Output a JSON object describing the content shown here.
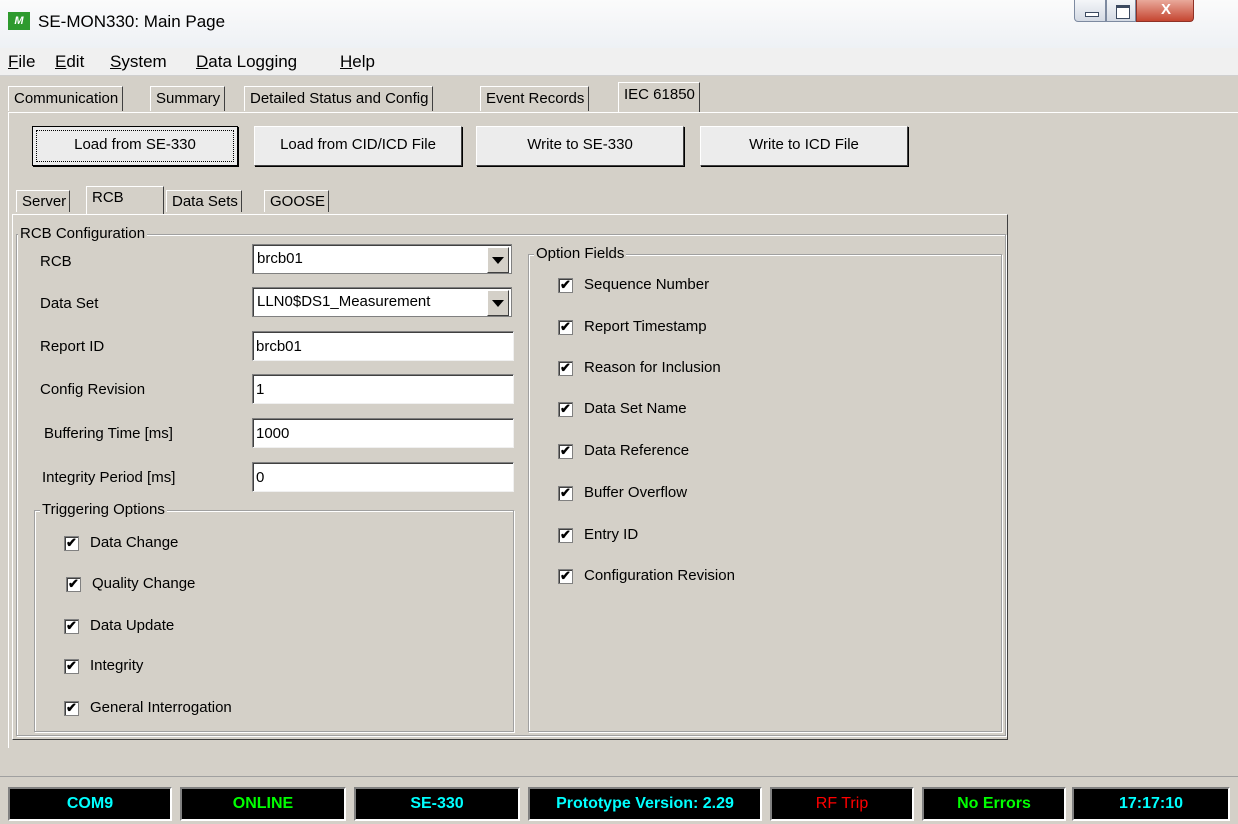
{
  "window": {
    "title": "SE-MON330: Main Page",
    "icon_text": "M",
    "close_label": "X"
  },
  "menu": [
    "File",
    "Edit",
    "System",
    "Data Logging",
    "Help"
  ],
  "main_tabs": [
    "Communication",
    "Summary",
    "Detailed Status and Config",
    "Event Records",
    "IEC 61850"
  ],
  "main_tab_active": "IEC 61850",
  "buttons": {
    "load_se": "Load from SE-330",
    "load_cid": "Load from CID/ICD File",
    "write_se": "Write to SE-330",
    "write_icd": "Write to ICD File"
  },
  "sub_tabs": [
    "Server",
    "RCB",
    "Data Sets",
    "GOOSE"
  ],
  "sub_tab_active": "RCB",
  "rcb_config": {
    "title": "RCB Configuration",
    "rcb_label": "RCB",
    "rcb_value": "brcb01",
    "dataset_label": "Data Set",
    "dataset_value": "LLN0$DS1_Measurement",
    "report_id_label": "Report ID",
    "report_id_value": "brcb01",
    "config_rev_label": "Config Revision",
    "config_rev_value": "1",
    "buf_time_label": "Buffering Time [ms]",
    "buf_time_value": "1000",
    "integrity_label": "Integrity Period [ms]",
    "integrity_value": "0"
  },
  "triggering": {
    "title": "Triggering Options",
    "items": [
      {
        "label": "Data Change",
        "checked": true
      },
      {
        "label": "Quality Change",
        "checked": true
      },
      {
        "label": "Data Update",
        "checked": true
      },
      {
        "label": "Integrity",
        "checked": true
      },
      {
        "label": "General Interrogation",
        "checked": true
      }
    ]
  },
  "options": {
    "title": "Option Fields",
    "items": [
      {
        "label": "Sequence Number",
        "checked": true
      },
      {
        "label": "Report Timestamp",
        "checked": true
      },
      {
        "label": "Reason for Inclusion",
        "checked": true
      },
      {
        "label": "Data Set Name",
        "checked": true
      },
      {
        "label": "Data Reference",
        "checked": true
      },
      {
        "label": "Buffer Overflow",
        "checked": true
      },
      {
        "label": "Entry ID",
        "checked": true
      },
      {
        "label": "Configuration Revision",
        "checked": true
      }
    ]
  },
  "check_mark": "✔",
  "status": [
    {
      "text": "COM9",
      "color": "#00ffff"
    },
    {
      "text": "ONLINE",
      "color": "#00ff00"
    },
    {
      "text": "SE-330",
      "color": "#00ffff"
    },
    {
      "text": "Prototype Version: 2.29",
      "color": "#00ffff"
    },
    {
      "text": "RF Trip",
      "color": "#ff0000"
    },
    {
      "text": "No Errors",
      "color": "#00ff00"
    },
    {
      "text": "17:17:10",
      "color": "#00ffff"
    }
  ]
}
